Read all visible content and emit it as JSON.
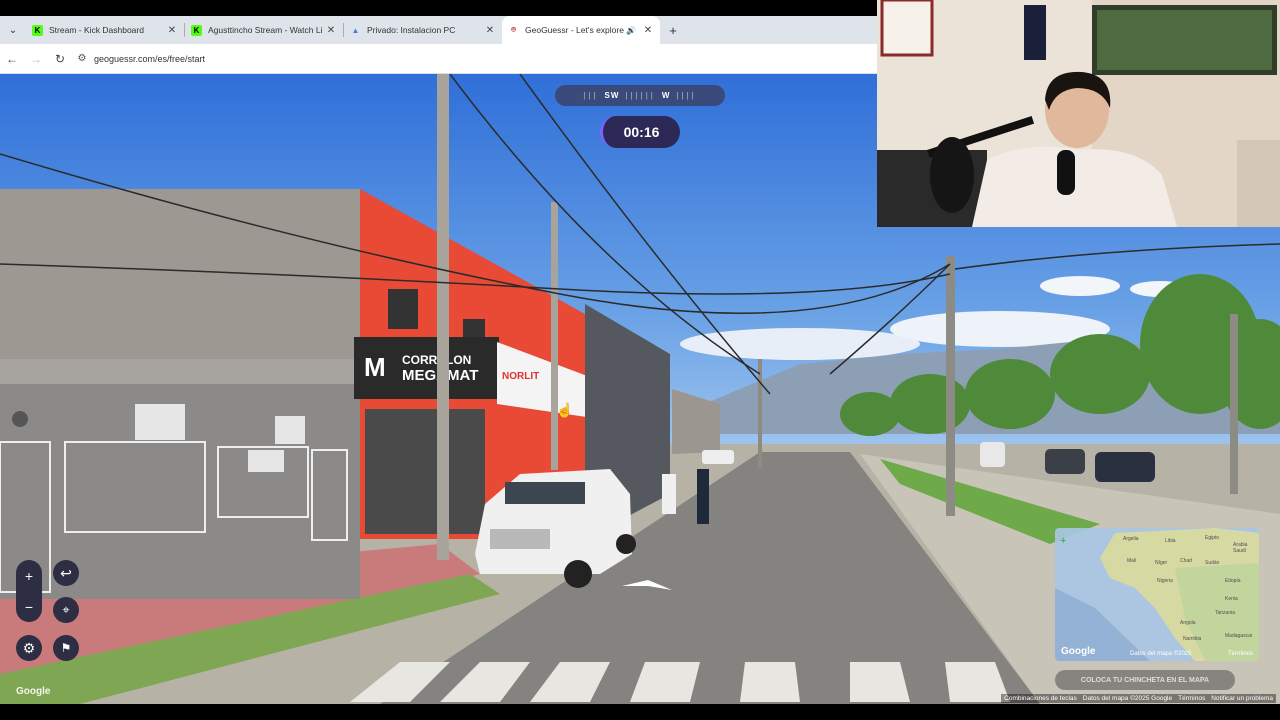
{
  "browser": {
    "tabs": [
      {
        "label": "Stream - Kick Dashboard",
        "favicon": "kick-icon",
        "active": false
      },
      {
        "label": "Agusttincho Stream - Watch Li",
        "favicon": "kick-icon",
        "active": false
      },
      {
        "label": "Privado: Instalacion PC",
        "favicon": "drive-icon",
        "active": false
      },
      {
        "label": "GeoGuessr - Let's explore t",
        "favicon": "geoguessr-pin-icon",
        "active": true
      }
    ],
    "url": "geoguessr.com/es/free/start"
  },
  "game": {
    "compass": {
      "left": "SW",
      "right": "W"
    },
    "timer": "00:16",
    "signs": {
      "corralon": "CORRALON",
      "megamat": "MEGAMAT",
      "norlit": "NORLIT",
      "sign_m": "M"
    },
    "controls": {
      "zoom_in": "+",
      "zoom_out": "−",
      "undo": "↩",
      "settings": "⚙",
      "checkpoint": "⚑",
      "pin": "⌖"
    },
    "map": {
      "labels": [
        "Argelia",
        "Libia",
        "Egipto",
        "Arabia Saudí",
        "Mali",
        "Níger",
        "Chad",
        "Sudán",
        "Nigeria",
        "Etiopía",
        "Kenia",
        "Tanzania",
        "Angola",
        "Madagascar",
        "Namibia"
      ],
      "zoom_in": "+",
      "google": "Google",
      "attribution": "Datos del mapa ©2025",
      "terms": "Términos",
      "place_button": "COLOCA TU CHINCHETA EN EL MAPA"
    },
    "google_logo": "Google",
    "footer": [
      "Combinaciones de teclas",
      "Datos del mapa ©2025 Google",
      "Términos",
      "Notificar un problema"
    ]
  },
  "colors": {
    "accent": "#7b62ff",
    "timer_bg": "#2c2956",
    "control_bg": "#2d2d44",
    "store_red": "#e84a36"
  }
}
